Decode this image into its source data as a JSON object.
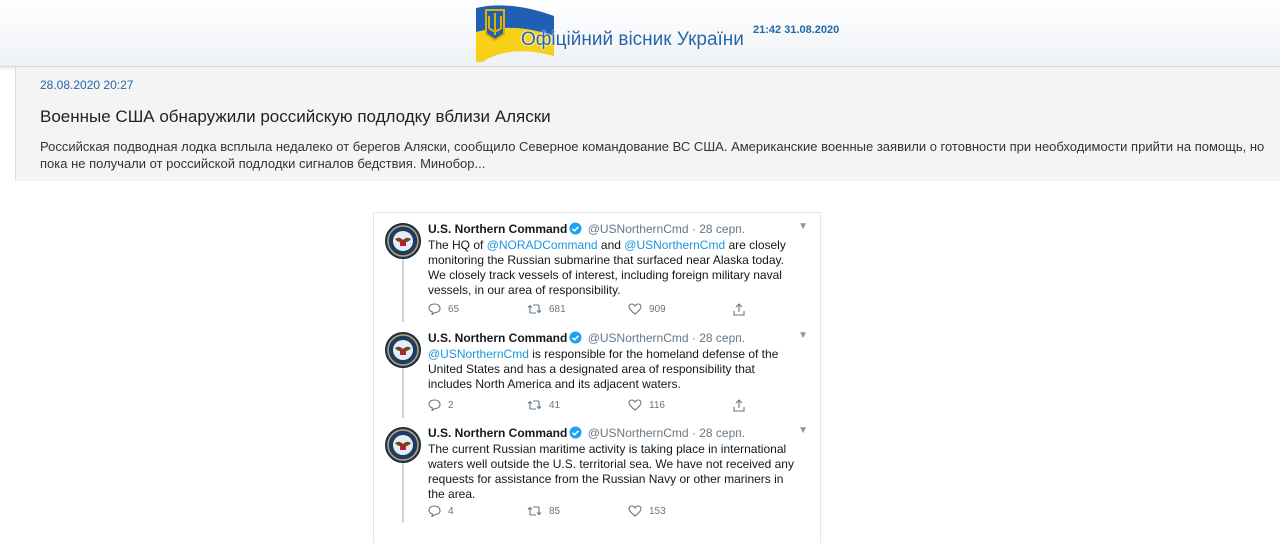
{
  "header": {
    "site_title": "Офіційний вісник України",
    "time": "21:42 31.08.2020",
    "flag_colors": {
      "blue": "#1f5fb4",
      "yellow": "#f7d117",
      "trident": "#e0b000"
    }
  },
  "article": {
    "date": "28.08.2020 20:27",
    "title": "Военные США обнаружили российскую подлодку вблизи Аляски",
    "lead": "Российская подводная лодка всплыла недалеко от берегов Аляски, сообщило Северное командование ВС США. Американские военные заявили о готовности при необходимости прийти на помощь, но пока не получали от российской подлодки сигналов бедствия. Минобор..."
  },
  "tweets": [
    {
      "name": "U.S. Northern Command",
      "handle": "@USNorthernCmd",
      "sep": "·",
      "date": "28 серп.",
      "body": [
        {
          "t": "The HQ of ",
          "m": false
        },
        {
          "t": "@NORADCommand",
          "m": true
        },
        {
          "t": " and ",
          "m": false
        },
        {
          "t": "@USNorthernCmd",
          "m": true
        },
        {
          "t": " are closely monitoring the Russian submarine that surfaced near Alaska today. We closely track vessels of interest, including foreign military naval vessels, in our area of responsibility.",
          "m": false
        }
      ],
      "replies": "65",
      "retweets": "681",
      "likes": "909"
    },
    {
      "name": "U.S. Northern Command",
      "handle": "@USNorthernCmd",
      "sep": "·",
      "date": "28 серп.",
      "body": [
        {
          "t": "@USNorthernCmd",
          "m": true
        },
        {
          "t": " is responsible for the homeland defense of the United States and has a designated area of responsibility that includes North America and its adjacent waters.",
          "m": false
        }
      ],
      "replies": "2",
      "retweets": "41",
      "likes": "116"
    },
    {
      "name": "U.S. Northern Command",
      "handle": "@USNorthernCmd",
      "sep": "·",
      "date": "28 серп.",
      "body": [
        {
          "t": "The current Russian maritime activity is taking place in international waters well outside the U.S. territorial sea. We have not received any requests for assistance from the Russian Navy or other mariners in the area.",
          "m": false
        }
      ],
      "replies": "4",
      "retweets": "85",
      "likes": "153"
    }
  ]
}
